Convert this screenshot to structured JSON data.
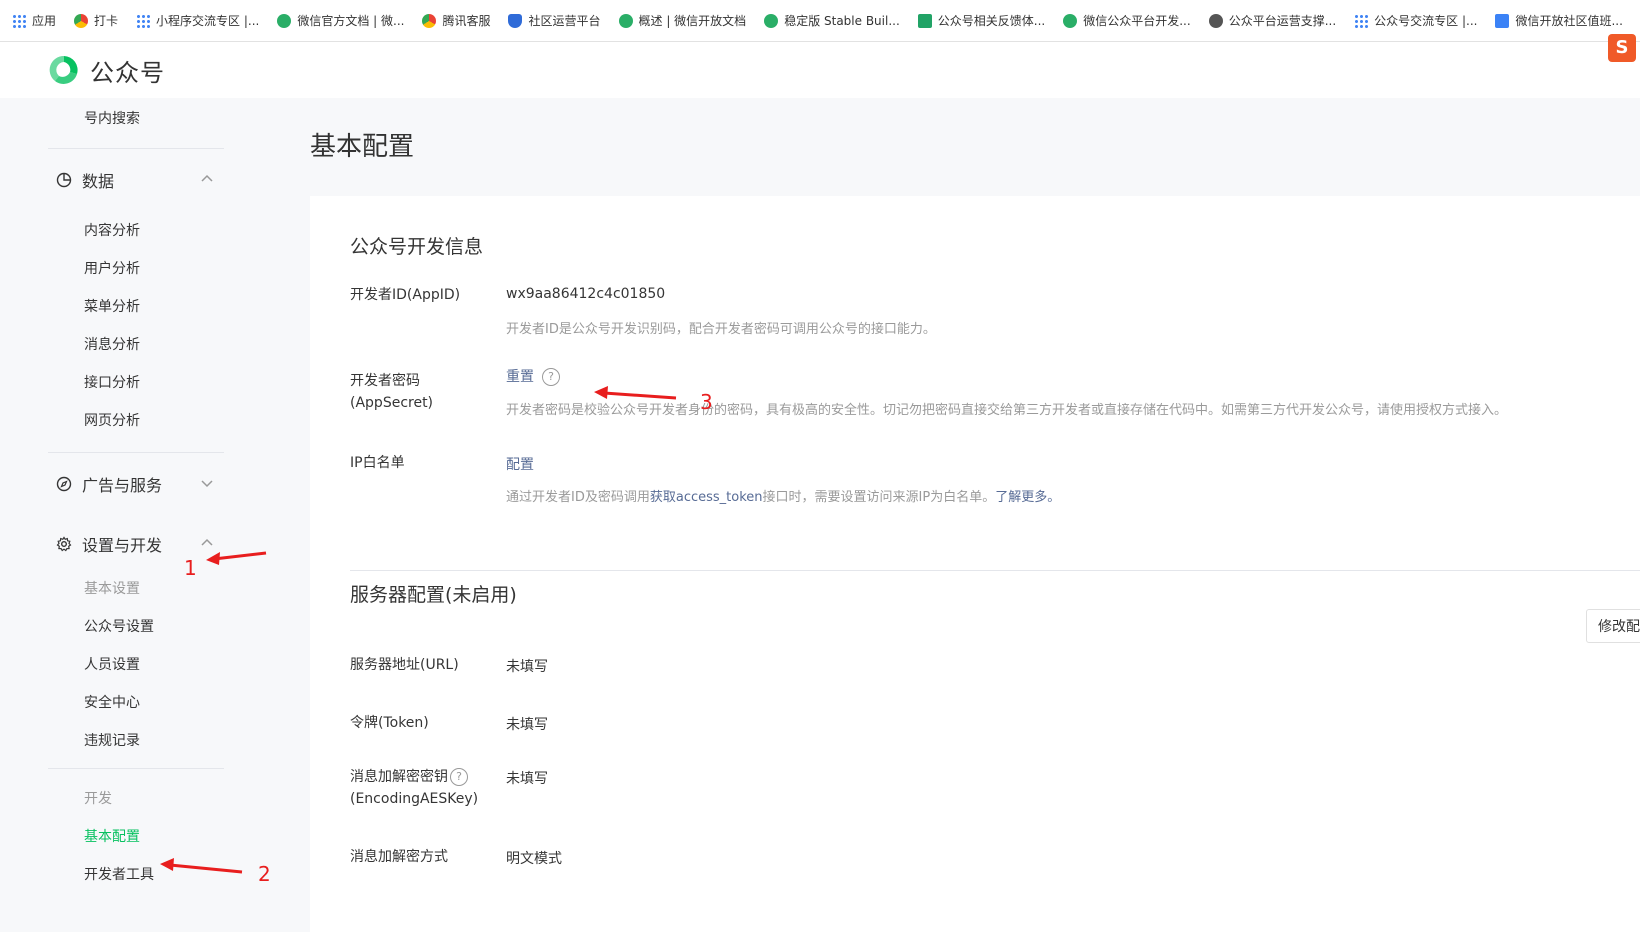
{
  "bookmarks": [
    {
      "label": "应用",
      "icon": "apps-grid-icon"
    },
    {
      "label": "打卡",
      "icon": "circle-icon"
    },
    {
      "label": "小程序交流专区 |...",
      "icon": "apps-grid-icon"
    },
    {
      "label": "微信官方文档 | 微...",
      "icon": "wechat-icon"
    },
    {
      "label": "腾讯客服",
      "icon": "circle-icon"
    },
    {
      "label": "社区运营平台",
      "icon": "shield-icon"
    },
    {
      "label": "概述 | 微信开放文档",
      "icon": "wechat-icon"
    },
    {
      "label": "稳定版 Stable Buil...",
      "icon": "wechat-icon"
    },
    {
      "label": "公众号相关反馈体...",
      "icon": "sheet-icon"
    },
    {
      "label": "微信公众平台开发...",
      "icon": "wechat-icon"
    },
    {
      "label": "公众平台运营支撑...",
      "icon": "globe-icon"
    },
    {
      "label": "公众号交流专区 |...",
      "icon": "apps-grid-icon"
    },
    {
      "label": "微信开放社区值班...",
      "icon": "doc-icon"
    }
  ],
  "header": {
    "logo_text": "公众号",
    "ext_badge": "S"
  },
  "sidebar": {
    "top_item": "号内搜索",
    "data_group": "数据",
    "data_items": [
      "内容分析",
      "用户分析",
      "菜单分析",
      "消息分析",
      "接口分析",
      "网页分析"
    ],
    "ads_group": "广告与服务",
    "settings_group": "设置与开发",
    "basic_heading": "基本设置",
    "basic_items": [
      "公众号设置",
      "人员设置",
      "安全中心",
      "违规记录"
    ],
    "dev_heading": "开发",
    "dev_active": "基本配置",
    "dev_tools": "开发者工具"
  },
  "page": {
    "title": "基本配置"
  },
  "dev_info": {
    "title": "公众号开发信息",
    "appid_label": "开发者ID(AppID)",
    "appid_value": "wx9aa86412c4c01850",
    "appid_desc": "开发者ID是公众号开发识别码，配合开发者密码可调用公众号的接口能力。",
    "secret_label": "开发者密码(AppSecret)",
    "secret_action": "重置",
    "secret_help": "?",
    "secret_desc": "开发者密码是校验公众号开发者身份的密码，具有极高的安全性。切记勿把密码直接交给第三方开发者或直接存储在代码中。如需第三方代开发公众号，请使用授权方式接入。",
    "ip_label": "IP白名单",
    "ip_action": "配置",
    "ip_desc_pre": "通过开发者ID及密码调用",
    "ip_desc_link": "获取access_token",
    "ip_desc_mid": "接口时，需要设置访问来源IP为白名单。",
    "ip_desc_more": "了解更多。"
  },
  "server": {
    "title": "服务器配置(未启用)",
    "edit_button": "修改配置",
    "url_label": "服务器地址(URL)",
    "url_value": "未填写",
    "token_label": "令牌(Token)",
    "token_value": "未填写",
    "aes_label": "消息加解密密钥",
    "aes_label2": "(EncodingAESKey)",
    "aes_help": "?",
    "aes_value": "未填写",
    "mode_label": "消息加解密方式",
    "mode_value": "明文模式"
  },
  "annotations": [
    "1",
    "2",
    "3"
  ],
  "colors": {
    "accent_green": "#07c160",
    "link": "#576b95",
    "annotation_red": "#e81e1e"
  }
}
